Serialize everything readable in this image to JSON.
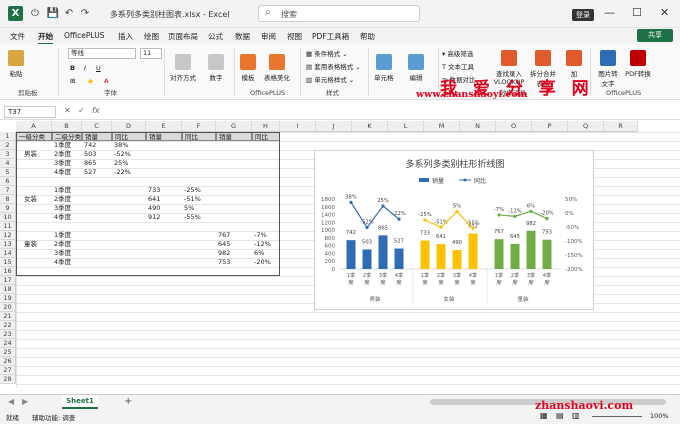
{
  "app": {
    "title": "多系列多类别柱图表.xlsx - Excel",
    "search_placeholder": "搜索",
    "login_label": "登录",
    "share_label": "共享"
  },
  "menu": [
    "文件",
    "开始",
    "OfficePLUS",
    "插入",
    "绘图",
    "页面布局",
    "公式",
    "数据",
    "审阅",
    "视图",
    "PDF工具箱",
    "帮助"
  ],
  "ribbon": {
    "paste": "粘贴",
    "clipboard": "剪贴板",
    "font_name": "等线",
    "font_size": "11",
    "font_group": "字体",
    "align": "对齐方式",
    "number": "数字",
    "template": "模板",
    "beautify": "表格美化",
    "officeplus": "OfficePLUS",
    "cond_format": "条件格式",
    "table_format": "套用表格格式",
    "cell_style": "单元格样式",
    "style_group": "样式",
    "cells": "单元格",
    "edit": "编辑",
    "adv_filter": "高级筛选",
    "text_tools": "文本工具",
    "merge_compare": "数据对比",
    "lookup": "查找录入 VLOOKUP",
    "split_merge": "拆分合并 表格",
    "add": "加",
    "img_convert": "图片转 文字",
    "pdf_convert": "PDF转换",
    "group_tools": "效率工具",
    "officeplus2": "OfficePLUS"
  },
  "watermark": {
    "cn": "我 爱 分 享 网",
    "url": "www.zhanshaoyi.com",
    "url2": "zhanshaoyi.com"
  },
  "namebox": "T37",
  "columns": [
    "A",
    "B",
    "C",
    "D",
    "E",
    "F",
    "G",
    "H",
    "I",
    "J",
    "K",
    "L",
    "M",
    "N",
    "O",
    "P",
    "Q",
    "R"
  ],
  "rows": [
    "1",
    "2",
    "3",
    "4",
    "5",
    "6",
    "7",
    "8",
    "9",
    "10",
    "11",
    "12",
    "13",
    "14",
    "15",
    "16",
    "17",
    "18",
    "19",
    "20",
    "21",
    "22",
    "23",
    "24",
    "25",
    "26",
    "27",
    "28"
  ],
  "table": {
    "header": [
      "一级分类",
      "二级分类",
      "销量",
      "同比",
      "销量",
      "同比",
      "销量",
      "同比"
    ],
    "groups": [
      "男装",
      "女装",
      "童装"
    ],
    "quarters": [
      "1季度",
      "2季度",
      "3季度",
      "4季度"
    ],
    "men": [
      [
        "742",
        "38%"
      ],
      [
        "503",
        "-52%"
      ],
      [
        "865",
        "25%"
      ],
      [
        "527",
        "-22%"
      ]
    ],
    "women": [
      [
        "733",
        "-25%"
      ],
      [
        "641",
        "-51%"
      ],
      [
        "490",
        "5%"
      ],
      [
        "912",
        "-55%"
      ]
    ],
    "kids": [
      [
        "767",
        "-7%"
      ],
      [
        "645",
        "-12%"
      ],
      [
        "982",
        "6%"
      ],
      [
        "753",
        "-20%"
      ]
    ]
  },
  "chart_data": {
    "type": "bar",
    "title": "多系列多类别柱形折线图",
    "categories": [
      "1季度",
      "2季度",
      "3季度",
      "4季度"
    ],
    "groups": [
      "男装",
      "女装",
      "童装"
    ],
    "series": [
      {
        "name": "销量",
        "values": [
          [
            742,
            503,
            865,
            527
          ],
          [
            733,
            641,
            490,
            912
          ],
          [
            767,
            645,
            982,
            753
          ]
        ],
        "colors": [
          "#2e6cb5",
          "#ffc000",
          "#70ad47"
        ]
      },
      {
        "name": "同比",
        "values": [
          [
            38,
            -52,
            25,
            -22
          ],
          [
            -25,
            -51,
            5,
            -55
          ],
          [
            -7,
            -12,
            6,
            -20
          ]
        ],
        "unit": "%"
      }
    ],
    "y_left_ticks": [
      "1800",
      "1600",
      "1400",
      "1200",
      "1000",
      "800",
      "600",
      "400",
      "200",
      "0"
    ],
    "y_right_ticks": [
      "50%",
      "0%",
      "-50%",
      "-100%",
      "-150%",
      "-200%"
    ],
    "ylim": [
      0,
      1800
    ],
    "y2lim": [
      -200,
      50
    ]
  },
  "sheet_tab": "Sheet1",
  "status": {
    "ready": "就绪",
    "accessibility": "辅助功能: 调查",
    "zoom": "100%"
  }
}
